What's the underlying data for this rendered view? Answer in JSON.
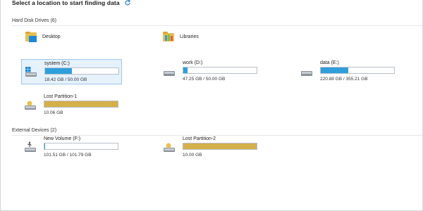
{
  "header": {
    "title": "Select a location to start finding data",
    "refresh_icon": "refresh-icon"
  },
  "colors": {
    "used": "#2f9fdc",
    "lost": "#d4b04a",
    "selected_bg": "#e5f1fb",
    "selected_border": "#9ec6ea"
  },
  "sections": {
    "hard_disk": {
      "label": "Hard Disk Drives (6)"
    },
    "external": {
      "label": "External Devices (2)"
    }
  },
  "locations": {
    "desktop": {
      "label": "Desktop",
      "icon": "desktop-folder-icon"
    },
    "libraries": {
      "label": "Libraries",
      "icon": "libraries-folder-icon"
    }
  },
  "drives": {
    "system_c": {
      "name": "system (C:)",
      "size": "18.42 GB / 50.00 GB",
      "used_fraction": 0.368,
      "kind": "used",
      "icon": "windows-drive-icon",
      "selected": true
    },
    "work_d": {
      "name": "work (D:)",
      "size": "47.25 GB / 50.00 GB",
      "used_fraction": 0.055,
      "kind": "used",
      "icon": "hard-drive-icon"
    },
    "data_e": {
      "name": "data (E:)",
      "size": "220.88 GB / 355.21 GB",
      "used_fraction": 0.378,
      "kind": "used",
      "icon": "hard-drive-icon"
    },
    "lost_1": {
      "name": "Lost Partition-1",
      "size": "10.06 GB",
      "used_fraction": 1.0,
      "kind": "lost",
      "icon": "lost-partition-icon"
    },
    "new_volume_f": {
      "name": "New Volume (F:)",
      "size": "101.51 GB / 101.79 GB",
      "used_fraction": 0.003,
      "kind": "used",
      "icon": "usb-drive-icon"
    },
    "lost_2": {
      "name": "Lost Partition-2",
      "size": "10.00 GB",
      "used_fraction": 1.0,
      "kind": "lost",
      "icon": "lost-partition-icon"
    }
  }
}
